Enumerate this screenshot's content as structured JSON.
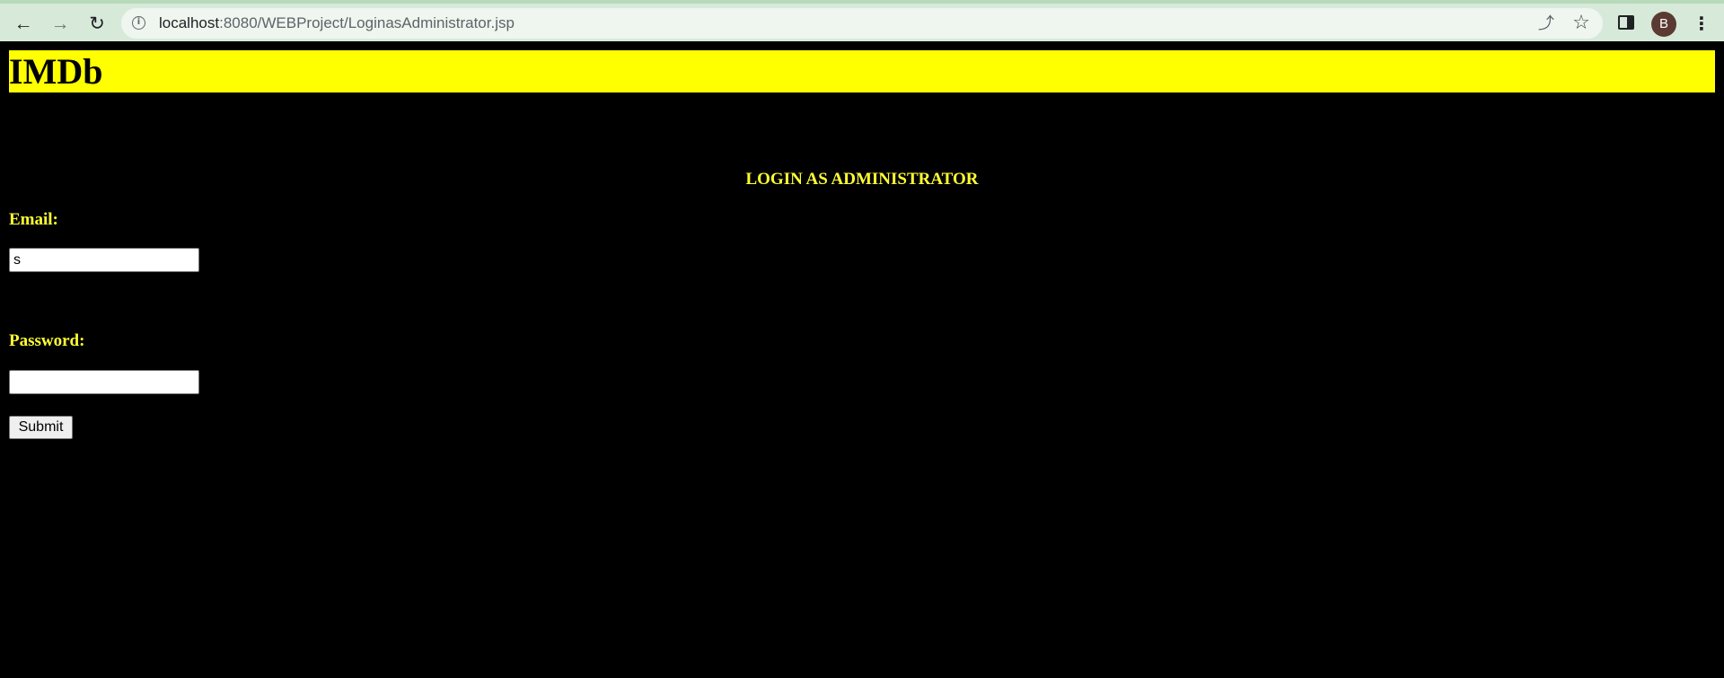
{
  "browser": {
    "url_host": "localhost",
    "url_path": ":8080/WEBProject/LoginasAdministrator.jsp",
    "profile_initial": "B",
    "icons": {
      "back": "back-arrow-icon",
      "forward": "forward-arrow-icon",
      "reload": "reload-icon",
      "site_info": "info-icon",
      "share": "share-icon",
      "bookmark": "star-icon",
      "side_panel": "side-panel-icon",
      "menu": "more-vert-icon"
    },
    "colors": {
      "toolbar": "#d7ead9",
      "address_bar": "#eef6ef",
      "avatar": "#5a3a33"
    }
  },
  "page": {
    "logo": "IMDb",
    "heading": "LOGIN AS ADMINISTRATOR",
    "email_label": "Email:",
    "email_value": "s",
    "password_label": "Password:",
    "password_value": "",
    "submit_label": "Submit",
    "colors": {
      "background": "#000000",
      "banner": "#ffff00",
      "label_text": "#ffff33"
    }
  }
}
